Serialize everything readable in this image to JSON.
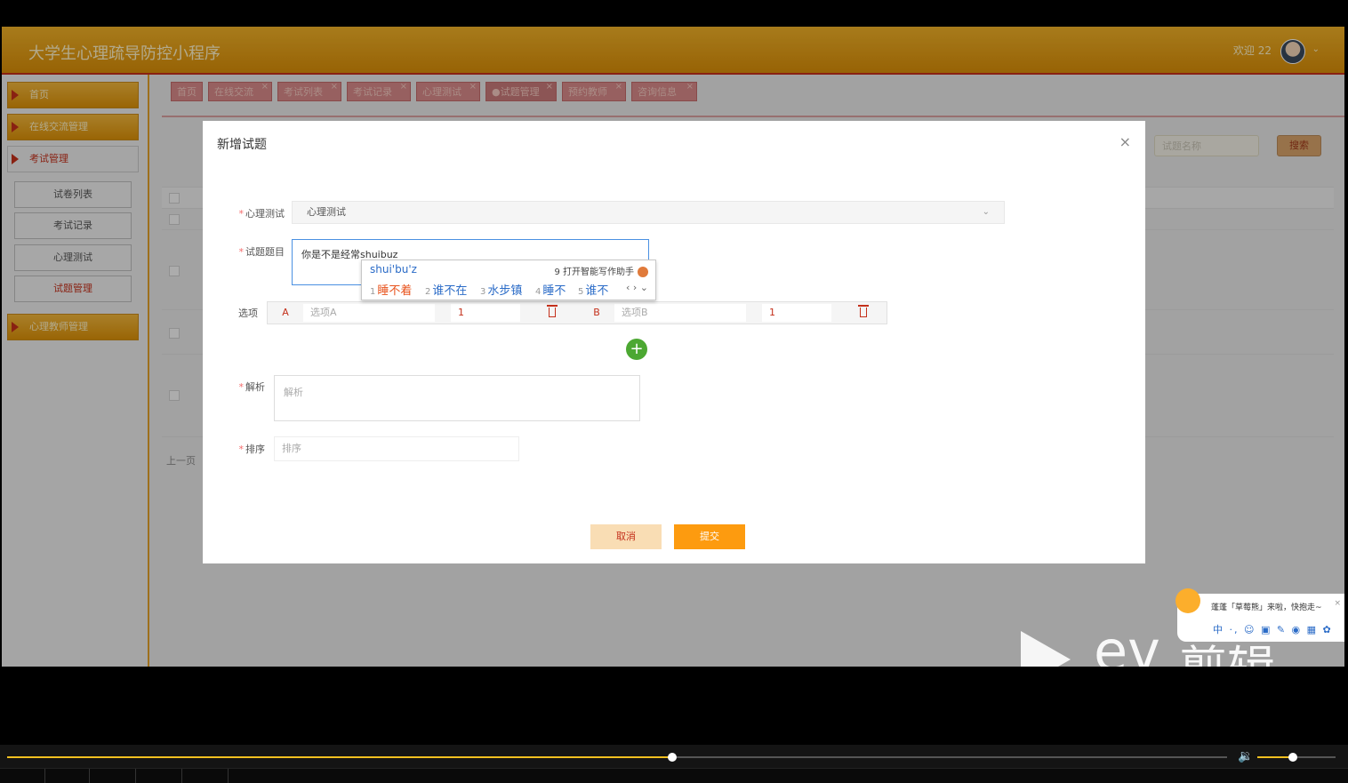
{
  "app": {
    "title": "大学生心理疏导防控小程序",
    "welcome": "欢迎 22"
  },
  "sidebar": {
    "items": [
      {
        "label": "首页"
      },
      {
        "label": "在线交流管理"
      },
      {
        "label": "考试管理"
      },
      {
        "label": "心理教师管理"
      }
    ],
    "subitems": [
      {
        "label": "试卷列表"
      },
      {
        "label": "考试记录"
      },
      {
        "label": "心理测试"
      },
      {
        "label": "试题管理"
      }
    ]
  },
  "tabs": [
    {
      "label": "首页"
    },
    {
      "label": "在线交流"
    },
    {
      "label": "考试列表"
    },
    {
      "label": "考试记录"
    },
    {
      "label": "心理测试"
    },
    {
      "label": "●试题管理"
    },
    {
      "label": "预约教师"
    },
    {
      "label": "咨询信息"
    }
  ],
  "background": {
    "search_placeholder": "试题名称",
    "search_button": "搜索",
    "prev_page": "上一页"
  },
  "modal": {
    "title": "新增试题",
    "close": "×",
    "fields": {
      "test": {
        "label": "心理测试",
        "value": "心理测试"
      },
      "stem": {
        "label": "试题题目",
        "value": "你是不是经常shuibuz"
      },
      "options": {
        "label": "选项"
      },
      "analysis": {
        "label": "解析",
        "placeholder": "解析"
      },
      "order": {
        "label": "排序",
        "placeholder": "排序"
      }
    },
    "required_mark": "*",
    "options": [
      {
        "letter": "A",
        "placeholder": "选项A",
        "score": "1"
      },
      {
        "letter": "B",
        "placeholder": "选项B",
        "score": "1"
      }
    ],
    "add_option": "+",
    "cancel": "取消",
    "submit": "提交"
  },
  "ime": {
    "pinyin": "shui'bu'z",
    "assist": "9 打开智能写作助手",
    "candidates": [
      {
        "num": "1",
        "text": "睡不着"
      },
      {
        "num": "2",
        "text": "谁不在"
      },
      {
        "num": "3",
        "text": "水步镇"
      },
      {
        "num": "4",
        "text": "睡不"
      },
      {
        "num": "5",
        "text": "谁不"
      }
    ],
    "more": "‹ › ⌄"
  },
  "watermark": {
    "ev_text": "ev",
    "ev_cn": "剪辑",
    "popup_text": "蓬蓬「草莓熊」来啦，快抱走~",
    "popup_close": "×",
    "popup_tools": "中 ·, ☺ ▣ ✎ ◉ ▦ ✿"
  },
  "player": {
    "progress": 0.545,
    "volume": 0.45,
    "volume_icon": "🔉"
  },
  "colors": {
    "accent": "#f0a81e",
    "danger": "#c4301b",
    "submit": "#fd9b0f",
    "add": "#4ca832"
  }
}
